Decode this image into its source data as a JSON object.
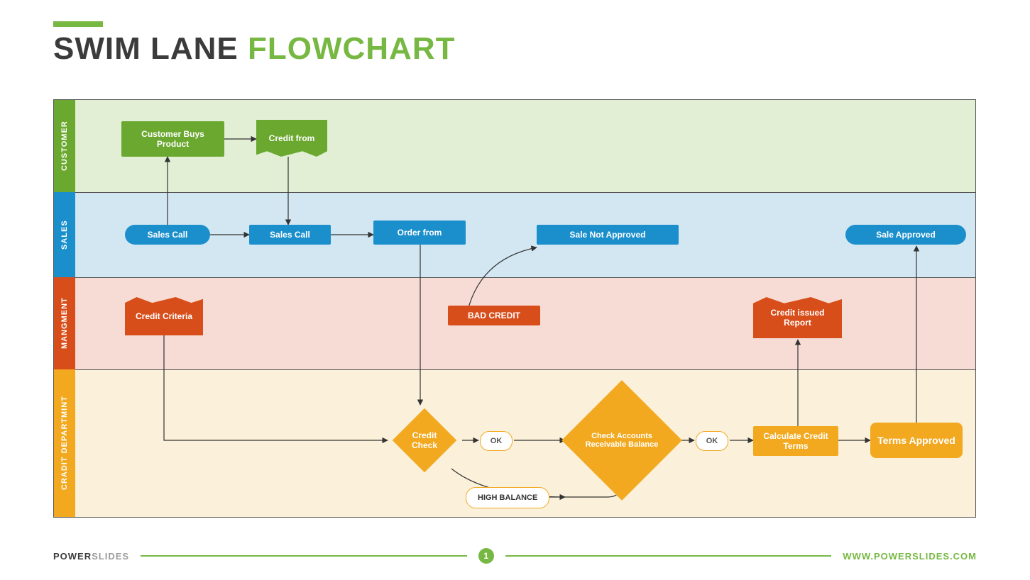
{
  "title": {
    "part1": "SWIM LANE ",
    "part2": "FLOWCHART"
  },
  "lanes": {
    "customer": "CUSTOMER",
    "sales": "SALES",
    "management": "MANGMENT",
    "credit": "CRADIT DEPARTMINT"
  },
  "nodes": {
    "cust_buys": "Customer Buys Product",
    "credit_from": "Credit from",
    "sales_call_1": "Sales Call",
    "sales_call_2": "Sales Call",
    "order_from": "Order from",
    "sale_not_approved": "Sale Not Approved",
    "sale_approved": "Sale Approved",
    "credit_criteria": "Credit Criteria",
    "bad_credit": "BAD CREDIT",
    "credit_issued_report": "Credit issued Report",
    "credit_check": "Credit Check",
    "check_accounts": "Check Accounts Receivable Balance",
    "calc_terms": "Calculate Credit Terms",
    "terms_approved": "Terms Approved",
    "ok1": "OK",
    "ok2": "OK",
    "high_balance": "HIGH BALANCE"
  },
  "footer": {
    "brand_bold": "POWER",
    "brand_light": "SLIDES",
    "page": "1",
    "url": "WWW.POWERSLIDES.COM"
  },
  "colors": {
    "green": "#6aa82f",
    "blue": "#1b8fcc",
    "orange": "#d84e1b",
    "gold": "#f2a920"
  }
}
